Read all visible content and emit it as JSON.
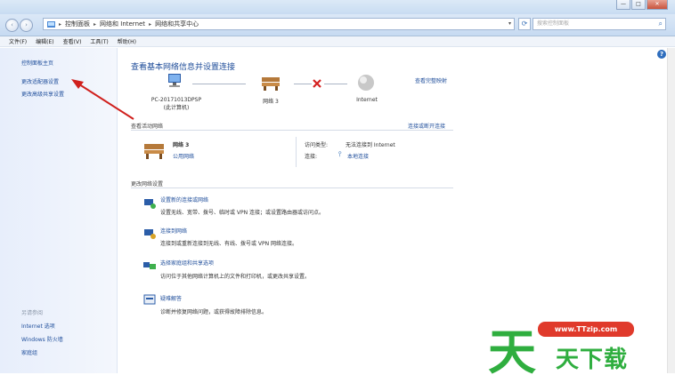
{
  "window": {
    "title": "",
    "caption": {
      "minimize": "—",
      "maximize": "□",
      "close": "✕"
    }
  },
  "address_bar": {
    "back_icon": "‹",
    "forward_icon": "›",
    "crumbs": [
      "控制面板",
      "网络和 Internet",
      "网络和共享中心"
    ],
    "search_placeholder": "搜索控制面板"
  },
  "menu": [
    "文件(F)",
    "编辑(E)",
    "查看(V)",
    "工具(T)",
    "帮助(H)"
  ],
  "sidebar": {
    "home": "控制面板主页",
    "links": [
      "更改适配器设置",
      "更改高级共享设置"
    ],
    "see_also_title": "另请参阅",
    "see_also": [
      "Internet 选项",
      "Windows 防火墙",
      "家庭组"
    ]
  },
  "main": {
    "heading": "查看基本网络信息并设置连接",
    "full_map": "查看完整映射",
    "nodes": [
      {
        "name": "PC-20171013DPSP",
        "sub": "(此计算机)"
      },
      {
        "name": "网络 3",
        "sub": ""
      },
      {
        "name": "Internet",
        "sub": ""
      }
    ],
    "active_networks_title": "查看活动网络",
    "connect_disconnect": "连接或断开连接",
    "network": {
      "name": "网络 3",
      "type": "公用网络"
    },
    "access_type_label": "访问类型:",
    "access_type_value": "无法连接到 Internet",
    "connection_label": "连接:",
    "connection_value": "本地连接",
    "change_settings_title": "更改网络设置",
    "items": [
      {
        "link": "设置新的连接或网络",
        "desc": "设置无线、宽带、拨号、临时或 VPN 连接；或设置路由器或访问点。"
      },
      {
        "link": "连接到网络",
        "desc": "连接到或重新连接到无线、有线、拨号或 VPN 网络连接。"
      },
      {
        "link": "选择家庭组和共享选项",
        "desc": "访问位于其他网络计算机上的文件和打印机，或更改共享设置。"
      },
      {
        "link": "疑难解答",
        "desc": "诊断并修复网络问题，或获得故障排除信息。"
      }
    ]
  },
  "watermark": {
    "big": "天",
    "url": "www.TTzip.com",
    "small": "天下载"
  },
  "colors": {
    "link": "#1f4e9b",
    "arrow": "#d0201d",
    "watermark_green": "#2fae3f",
    "watermark_red": "#e03a2b"
  }
}
